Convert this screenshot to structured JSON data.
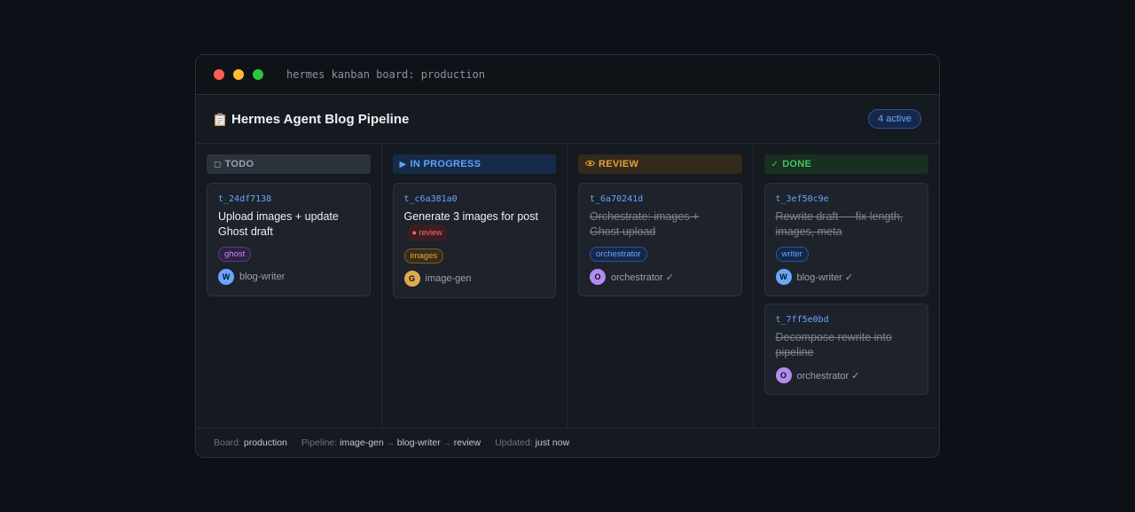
{
  "window": {
    "title": "hermes kanban board: production"
  },
  "header": {
    "icon": "clipboard-icon",
    "title": "Hermes Agent Blog Pipeline",
    "active_badge": "4 active"
  },
  "columns": [
    {
      "label": "TODO",
      "icon": "square-icon",
      "icon_glyph": "◻",
      "cards": [
        {
          "id": "t_24df7138",
          "title": "Upload images + update Ghost draft",
          "tag": "ghost",
          "assignee_initial": "W",
          "assignee": "blog-writer"
        }
      ]
    },
    {
      "label": "IN PROGRESS",
      "icon": "play-icon",
      "icon_glyph": "▶",
      "cards": [
        {
          "id": "t_c6a381a0",
          "title": "Generate 3 images for post",
          "inline_badge": "review",
          "tag": "images",
          "assignee_initial": "G",
          "assignee": "image-gen"
        }
      ]
    },
    {
      "label": "REVIEW",
      "icon": "eye-icon",
      "icon_glyph": "👁",
      "cards": [
        {
          "id": "t_6a70241d",
          "title": "Orchestrate: images + Ghost upload",
          "tag": "orchestrator",
          "assignee_initial": "O",
          "assignee": "orchestrator ✓"
        }
      ]
    },
    {
      "label": "DONE",
      "icon": "check-icon",
      "icon_glyph": "✓",
      "cards": [
        {
          "id": "t_3ef50c9e",
          "title": "Rewrite draft — fix length, images, meta",
          "tag": "writer",
          "assignee_initial": "W",
          "assignee": "blog-writer ✓"
        },
        {
          "id": "t_7ff5e0bd",
          "title": "Decompose rewrite into pipeline",
          "assignee_initial": "O",
          "assignee": "orchestrator ✓"
        }
      ]
    }
  ],
  "footer": {
    "board_label": "Board:",
    "board_value": "production",
    "pipeline_label": "Pipeline:",
    "pipeline_steps": [
      "image-gen",
      "blog-writer",
      "review"
    ],
    "arrow": "→",
    "updated_label": "Updated:",
    "updated_value": "just now"
  },
  "colors": {
    "background": "#0d1016",
    "window": "#151920",
    "accent_blue": "#6aa6ff",
    "todo": "#9aa2b0",
    "in_progress": "#5ea3ff",
    "review": "#e2a23c",
    "done": "#47c266",
    "traffic_red": "#ff5f57",
    "traffic_yellow": "#febc2e",
    "traffic_green": "#28c840"
  }
}
